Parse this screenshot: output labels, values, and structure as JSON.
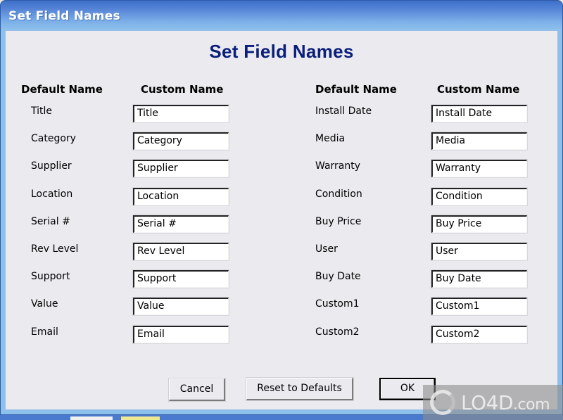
{
  "window": {
    "title": "Set Field Names"
  },
  "dialog": {
    "heading": "Set Field Names",
    "columns": {
      "left": {
        "default_header": "Default Name",
        "custom_header": "Custom Name"
      },
      "right": {
        "default_header": "Default Name",
        "custom_header": "Custom Name"
      }
    },
    "left_fields": [
      {
        "default": "Title",
        "custom": "Title"
      },
      {
        "default": "Category",
        "custom": "Category"
      },
      {
        "default": "Supplier",
        "custom": "Supplier"
      },
      {
        "default": "Location",
        "custom": "Location"
      },
      {
        "default": "Serial #",
        "custom": "Serial #"
      },
      {
        "default": "Rev Level",
        "custom": "Rev Level"
      },
      {
        "default": "Support",
        "custom": "Support"
      },
      {
        "default": "Value",
        "custom": "Value"
      },
      {
        "default": "Email",
        "custom": "Email"
      }
    ],
    "right_fields": [
      {
        "default": "Install Date",
        "custom": "Install Date"
      },
      {
        "default": "Media",
        "custom": "Media"
      },
      {
        "default": "Warranty",
        "custom": "Warranty"
      },
      {
        "default": "Condition",
        "custom": "Condition"
      },
      {
        "default": "Buy Price",
        "custom": "Buy Price"
      },
      {
        "default": "User",
        "custom": "User"
      },
      {
        "default": "Buy Date",
        "custom": "Buy Date"
      },
      {
        "default": "Custom1",
        "custom": "Custom1"
      },
      {
        "default": "Custom2",
        "custom": "Custom2"
      }
    ],
    "buttons": {
      "cancel": "Cancel",
      "reset": "Reset to Defaults",
      "ok": "OK"
    }
  },
  "watermark": {
    "text": "LO4D",
    "suffix": ".com"
  },
  "colors": {
    "heading": "#0a1e7a",
    "titlebar": "#5a89d9",
    "client_bg": "#ebeaef"
  }
}
